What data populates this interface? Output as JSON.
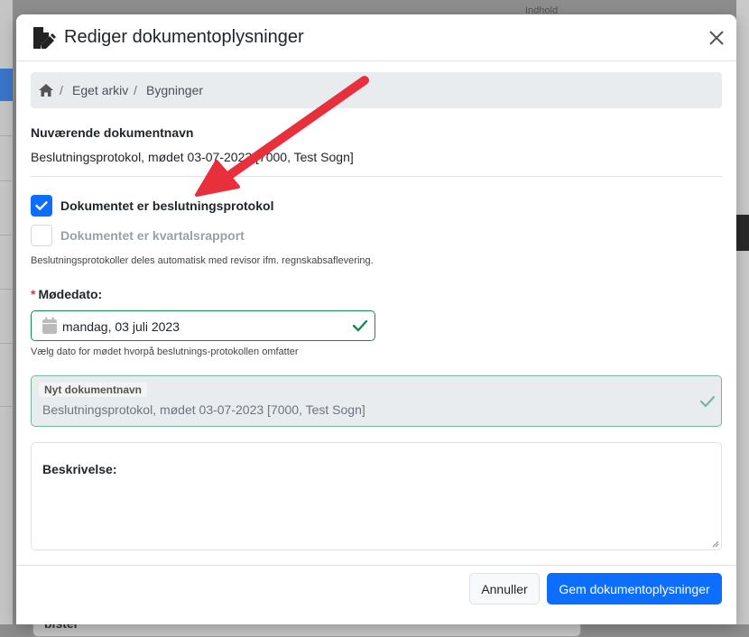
{
  "background": {
    "top_label": "Indhold",
    "bottom_partial_text": "bister"
  },
  "modal": {
    "title": "Rediger dokumentoplysninger",
    "close_label": "×",
    "breadcrumb": [
      "Eget arkiv",
      "Bygninger"
    ],
    "current_name_label": "Nuværende dokumentnavn",
    "current_name_value": "Beslutningsprotokol, mødet 03-07-2023 [7000, Test Sogn]",
    "checkbox_protocol": {
      "label": "Dokumentet er beslutningsprotokol",
      "checked": true
    },
    "checkbox_quarterly": {
      "label": "Dokumentet er kvartalsrapport",
      "checked": false,
      "disabled": true
    },
    "protocol_help": "Beslutningsprotokoller deles automatisk med revisor ifm. regnskabsaflevering.",
    "meeting_date_required": "*",
    "meeting_date_label": "Mødedato:",
    "meeting_date_value": "mandag, 03 juli 2023",
    "meeting_date_help": "Vælg dato for mødet hvorpå beslutnings-protokollen omfatter",
    "new_name_label": "Nyt dokumentnavn",
    "new_name_value": "Beslutningsprotokol, mødet 03-07-2023 [7000, Test Sogn]",
    "description_label": "Beskrivelse:",
    "cancel_label": "Annuller",
    "save_label": "Gem dokumentoplysninger"
  },
  "colors": {
    "primary": "#0d6efd",
    "success": "#198754",
    "annotation_arrow": "#e8303d"
  },
  "icons": [
    "file-edit-icon",
    "close-icon",
    "home-icon",
    "check-icon",
    "calendar-icon",
    "valid-check-icon",
    "arrow-annotation"
  ]
}
